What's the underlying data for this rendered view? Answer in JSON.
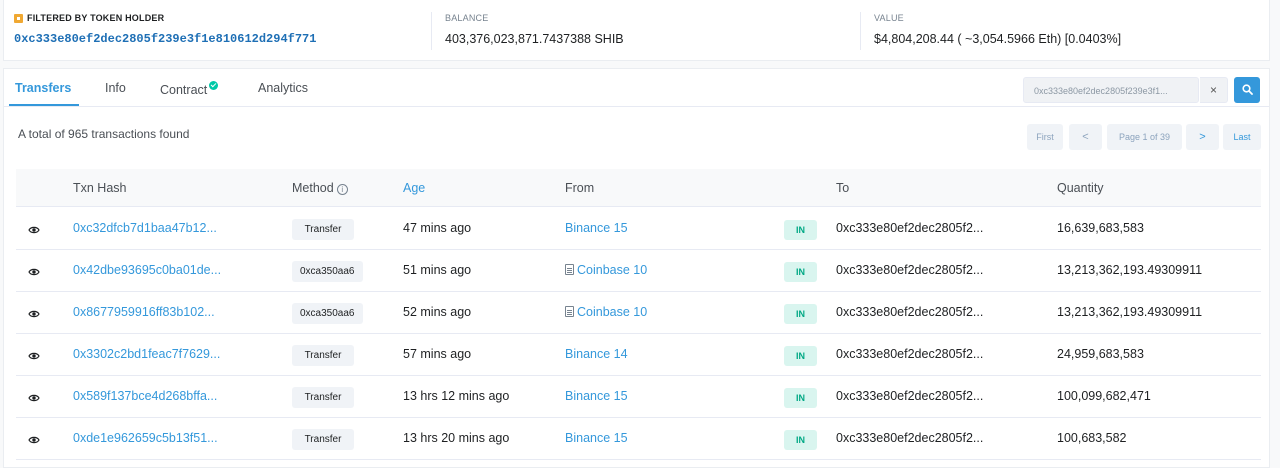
{
  "summary": {
    "filter_label": "FILTERED BY TOKEN HOLDER",
    "holder_address": "0xc333e80ef2dec2805f239e3f1e810612d294f771",
    "balance_label": "BALANCE",
    "balance_value": "403,376,023,871.7437388 SHIB",
    "value_label": "VALUE",
    "value_value": "$4,804,208.44 ( ~3,054.5966 Eth) [0.0403%]"
  },
  "tabs": [
    "Transfers",
    "Info",
    "Contract",
    "Analytics"
  ],
  "search": {
    "value": "0xc333e80ef2dec2805f239e3f1...",
    "clear": "×"
  },
  "total_text": "A total of 965 transactions found",
  "pager": {
    "first": "First",
    "prev": "<",
    "info": "Page 1 of 39",
    "next": ">",
    "last": "Last"
  },
  "columns": [
    "Txn Hash",
    "Method",
    "Age",
    "From",
    "To",
    "Quantity"
  ],
  "method_info": "i",
  "rows": [
    {
      "hash": "0xc32dfcb7d1baa47b12...",
      "method": "Transfer",
      "age": "47 mins ago",
      "from": "Binance 15",
      "from_doc": false,
      "dir": "IN",
      "to": "0xc333e80ef2dec2805f2...",
      "qty": "16,639,683,583"
    },
    {
      "hash": "0x42dbe93695c0ba01de...",
      "method": "0xca350aa6",
      "age": "51 mins ago",
      "from": "Coinbase 10",
      "from_doc": true,
      "dir": "IN",
      "to": "0xc333e80ef2dec2805f2...",
      "qty": "13,213,362,193.49309911"
    },
    {
      "hash": "0x8677959916ff83b102...",
      "method": "0xca350aa6",
      "age": "52 mins ago",
      "from": "Coinbase 10",
      "from_doc": true,
      "dir": "IN",
      "to": "0xc333e80ef2dec2805f2...",
      "qty": "13,213,362,193.49309911"
    },
    {
      "hash": "0x3302c2bd1feac7f7629...",
      "method": "Transfer",
      "age": "57 mins ago",
      "from": "Binance 14",
      "from_doc": false,
      "dir": "IN",
      "to": "0xc333e80ef2dec2805f2...",
      "qty": "24,959,683,583"
    },
    {
      "hash": "0x589f137bce4d268bffa...",
      "method": "Transfer",
      "age": "13 hrs 12 mins ago",
      "from": "Binance 15",
      "from_doc": false,
      "dir": "IN",
      "to": "0xc333e80ef2dec2805f2...",
      "qty": "100,099,682,471"
    },
    {
      "hash": "0xde1e962659c5b13f51...",
      "method": "Transfer",
      "age": "13 hrs 20 mins ago",
      "from": "Binance 15",
      "from_doc": false,
      "dir": "IN",
      "to": "0xc333e80ef2dec2805f2...",
      "qty": "100,683,582"
    }
  ],
  "colors": {
    "accent": "#3498db",
    "in_badge_bg": "#d9f5ef",
    "in_badge_fg": "#00a884",
    "verified": "#00c9a7"
  }
}
